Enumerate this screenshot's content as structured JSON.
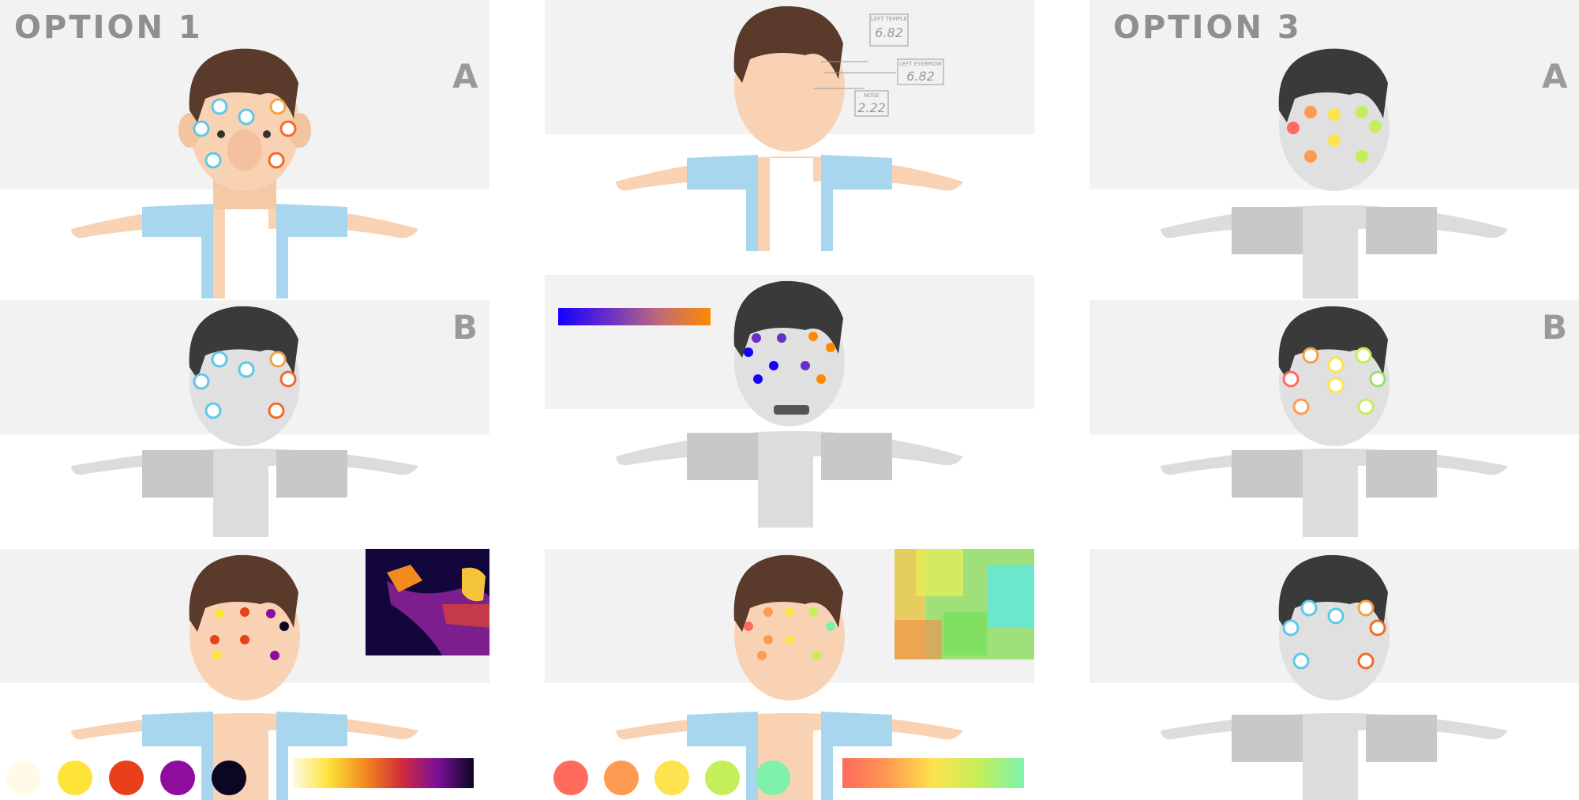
{
  "titles": {
    "option1": "OPTION 1",
    "option3": "OPTION 3"
  },
  "letters": {
    "a": "A",
    "b": "B"
  },
  "callouts": [
    {
      "label": "LEFT TEMPLE",
      "value": "6.82"
    },
    {
      "label": "LEFT EYEBROW",
      "value": "6.82"
    },
    {
      "label": "NOSE",
      "value": "2.22"
    }
  ],
  "colors": {
    "skin": "#f9d2b3",
    "hair": "#5a3a2b",
    "shirt_blue": "#a9d6ef",
    "grey_skin": "#dcdcdc",
    "grey_hair": "#3a3a3a",
    "bg": "#f2f2f2"
  },
  "palette_heat": [
    "#fffbe8",
    "#fde33a",
    "#e8411a",
    "#8e0c9e",
    "#0b0622"
  ],
  "palette_spectrum": [
    "#ff6b5c",
    "#ff9a52",
    "#fde34d",
    "#c4ef5a",
    "#7ef2ad"
  ],
  "gradients": {
    "blue_orange": "linear-gradient(90deg,#1500ff,#6a2fc8,#c06a7a,#ff8a00)",
    "inferno": "linear-gradient(90deg,#fffbe8,#fde33a,#f28a1f,#d22d39,#7c0e9a,#0b0622)",
    "spectrum": "linear-gradient(90deg,#ff6b5c,#ff9a52,#fde34d,#c4ef5a,#7ef2ad)"
  }
}
